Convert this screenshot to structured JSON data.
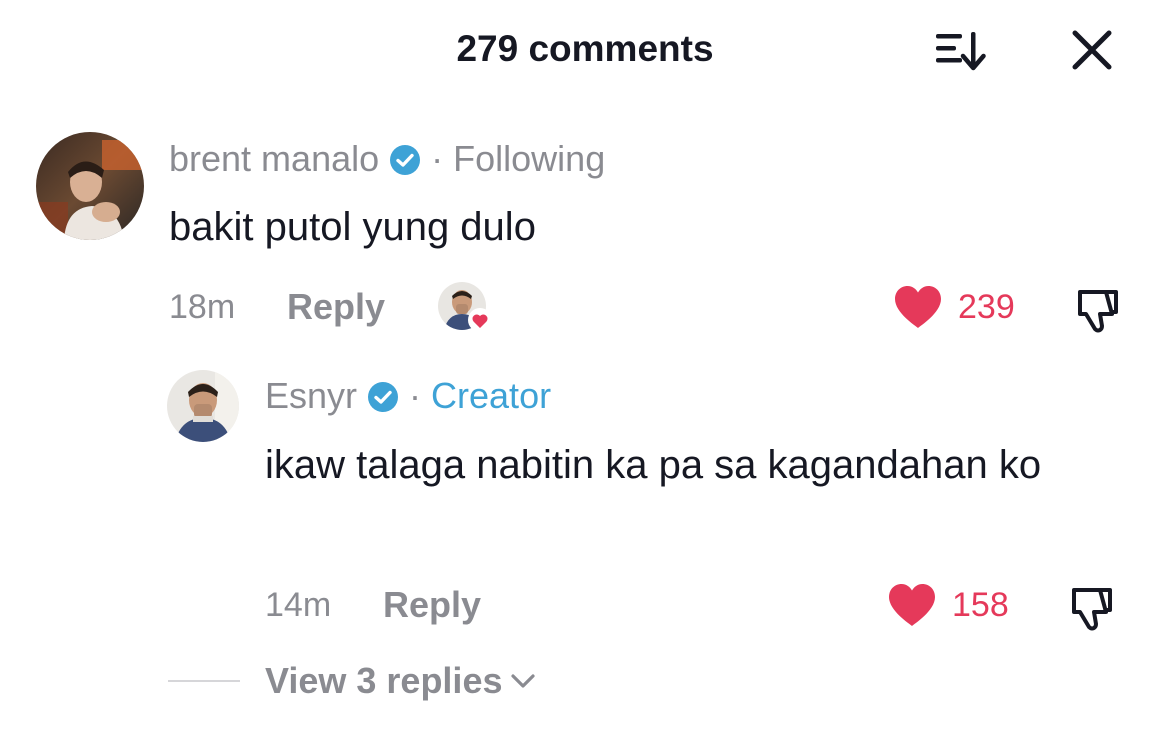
{
  "header": {
    "title": "279 comments",
    "sort_icon": "sort-icon",
    "close_icon": "close-icon"
  },
  "comments": [
    {
      "author": "brent manalo",
      "verified": true,
      "separator": "·",
      "relation": "Following",
      "text": "bakit putol yung dulo",
      "time": "18m",
      "reply_label": "Reply",
      "liked_by_creator": true,
      "likes": "239"
    }
  ],
  "reply": {
    "author": "Esnyr",
    "verified": true,
    "separator": "·",
    "badge": "Creator",
    "text": "ikaw talaga nabitin ka pa sa kagandahan ko",
    "time": "14m",
    "reply_label": "Reply",
    "likes": "158"
  },
  "view_replies": {
    "label": "View 3 replies"
  },
  "colors": {
    "accent_like": "#e5395a",
    "verified_blue": "#3ea2d6",
    "secondary_text": "#8a8b91",
    "primary_text": "#161823"
  }
}
